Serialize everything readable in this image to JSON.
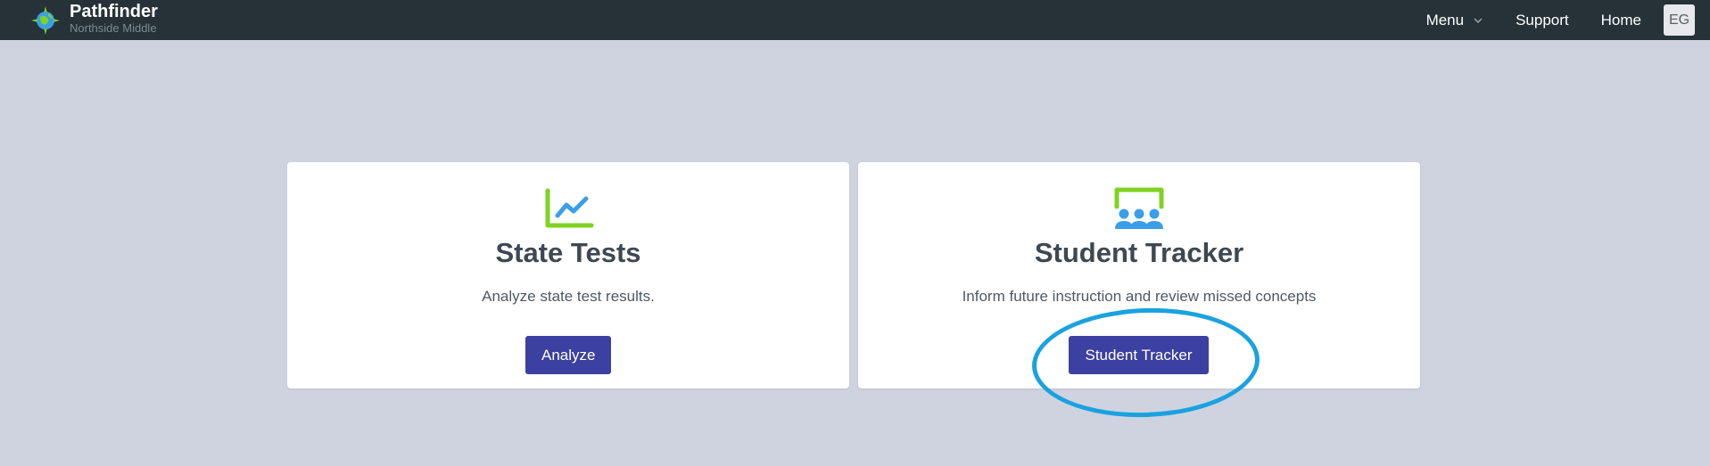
{
  "app": {
    "title": "Pathfinder",
    "school": "Northside Middle",
    "logo_icon": "compass-globe-icon"
  },
  "nav": {
    "menu_label": "Menu",
    "menu_icon": "chevron-down-icon",
    "support_label": "Support",
    "home_label": "Home",
    "avatar_initials": "EG"
  },
  "cards": [
    {
      "icon": "line-chart-icon",
      "title": "State Tests",
      "description": "Analyze state test results.",
      "button_label": "Analyze"
    },
    {
      "icon": "classroom-students-icon",
      "title": "Student Tracker",
      "description": "Inform future instruction and review missed concepts",
      "button_label": "Student Tracker"
    }
  ],
  "colors": {
    "topbar_bg": "#263238",
    "page_bg": "#cfd3e0",
    "button_bg": "#3c40a0",
    "icon_green": "#7ed321",
    "icon_blue": "#3b9ee8",
    "highlight_ring": "#1aa2e0"
  }
}
